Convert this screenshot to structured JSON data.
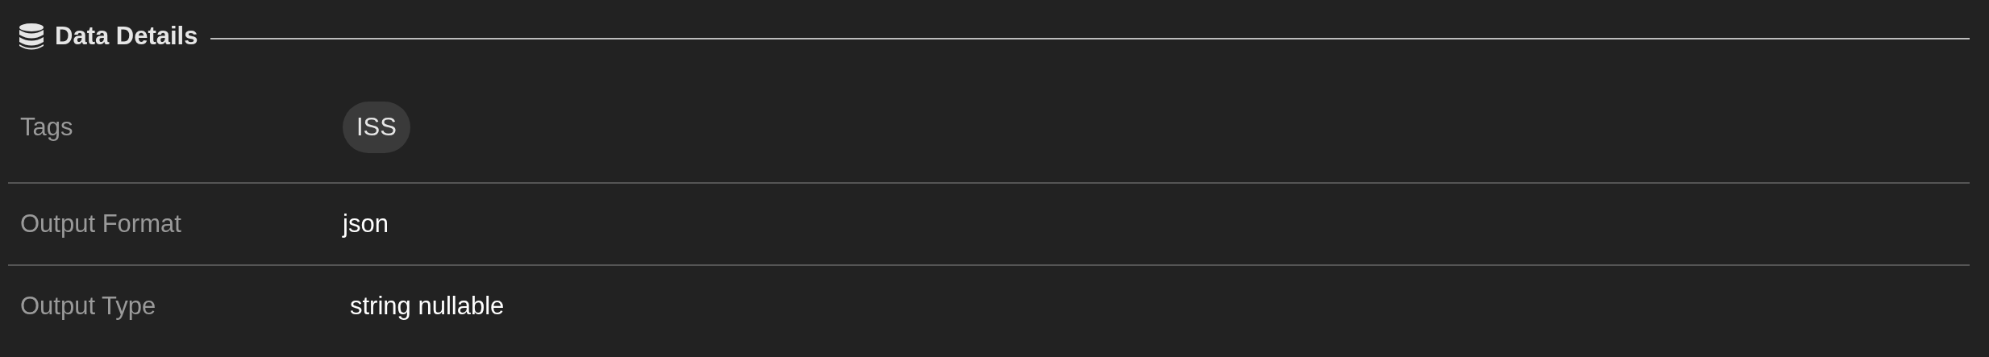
{
  "section": {
    "title": "Data Details"
  },
  "rows": [
    {
      "label": "Tags",
      "kind": "tags",
      "tags": [
        "ISS"
      ]
    },
    {
      "label": "Output Format",
      "kind": "text",
      "value": "json"
    },
    {
      "label": "Output Type",
      "kind": "type",
      "value": "string nullable"
    }
  ]
}
